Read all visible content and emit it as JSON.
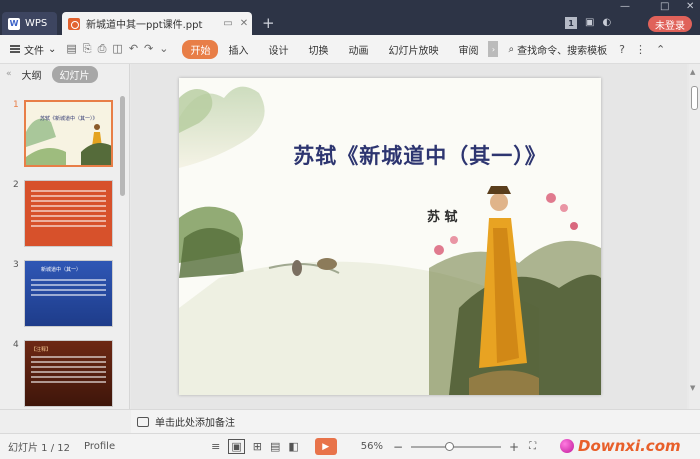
{
  "app": {
    "name": "WPS",
    "tab_title": "新城道中其一ppt课件.ppt",
    "new_tab": "+",
    "login_label": "未登录",
    "doc_count": "1"
  },
  "ribbon": {
    "file_label": "文件",
    "tabs": [
      "开始",
      "插入",
      "设计",
      "切换",
      "动画",
      "幻灯片放映",
      "审阅"
    ],
    "active_tab": "开始",
    "search_label": "查找命令、搜索模板",
    "help": "?"
  },
  "left_panel": {
    "tabs": [
      "大纲",
      "幻灯片"
    ],
    "active_tab": "幻灯片",
    "thumbnails": [
      {
        "num": "1",
        "color": "#f7f3e2",
        "caption": "苏轼《新城道中（其一）》"
      },
      {
        "num": "2",
        "color": "#d7512b"
      },
      {
        "num": "3",
        "color": "#2f57b5",
        "caption": "新城道中（其一）"
      },
      {
        "num": "4",
        "color": "#7b2d18",
        "caption": "【注释】"
      }
    ],
    "add_label": "+"
  },
  "slide": {
    "title": "苏轼《新城道中（其一）》",
    "author": "苏 轼"
  },
  "notes": {
    "placeholder": "单击此处添加备注"
  },
  "status": {
    "slide_counter": "幻灯片 1 / 12",
    "profile": "Profile",
    "zoom": "56%",
    "zoom_fraction": 0.42,
    "zoom_minus": "−",
    "zoom_plus": "+"
  },
  "watermark": "Downxi.com",
  "colors": {
    "accent": "#e87e47",
    "titlebar": "#2d3446",
    "login": "#e0625a"
  }
}
